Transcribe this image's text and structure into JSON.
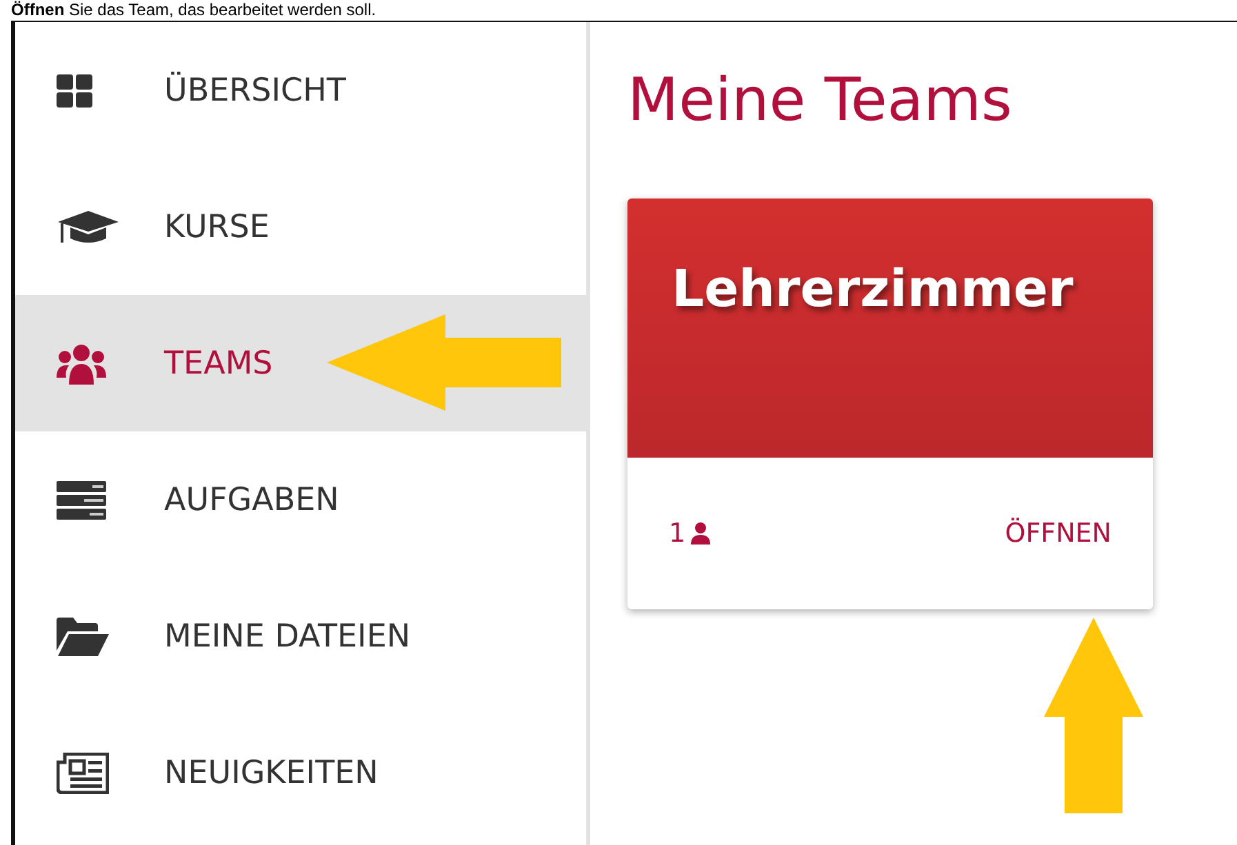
{
  "instruction": "**Öffnen** Sie das Team, das bearbeitet werden soll.",
  "sidebar": {
    "items": [
      {
        "label": "ÜBERSICHT",
        "selected": false
      },
      {
        "label": "KURSE",
        "selected": false
      },
      {
        "label": "TEAMS",
        "selected": true
      },
      {
        "label": "AUFGABEN",
        "selected": false
      },
      {
        "label": "MEINE DATEIEN",
        "selected": false
      },
      {
        "label": "NEUIGKEITEN",
        "selected": false
      }
    ]
  },
  "main": {
    "title": "Meine Teams",
    "team_card": {
      "title": "Lehrerzimmer",
      "member_count": "1",
      "open_link": "ÖFFNEN"
    }
  }
}
